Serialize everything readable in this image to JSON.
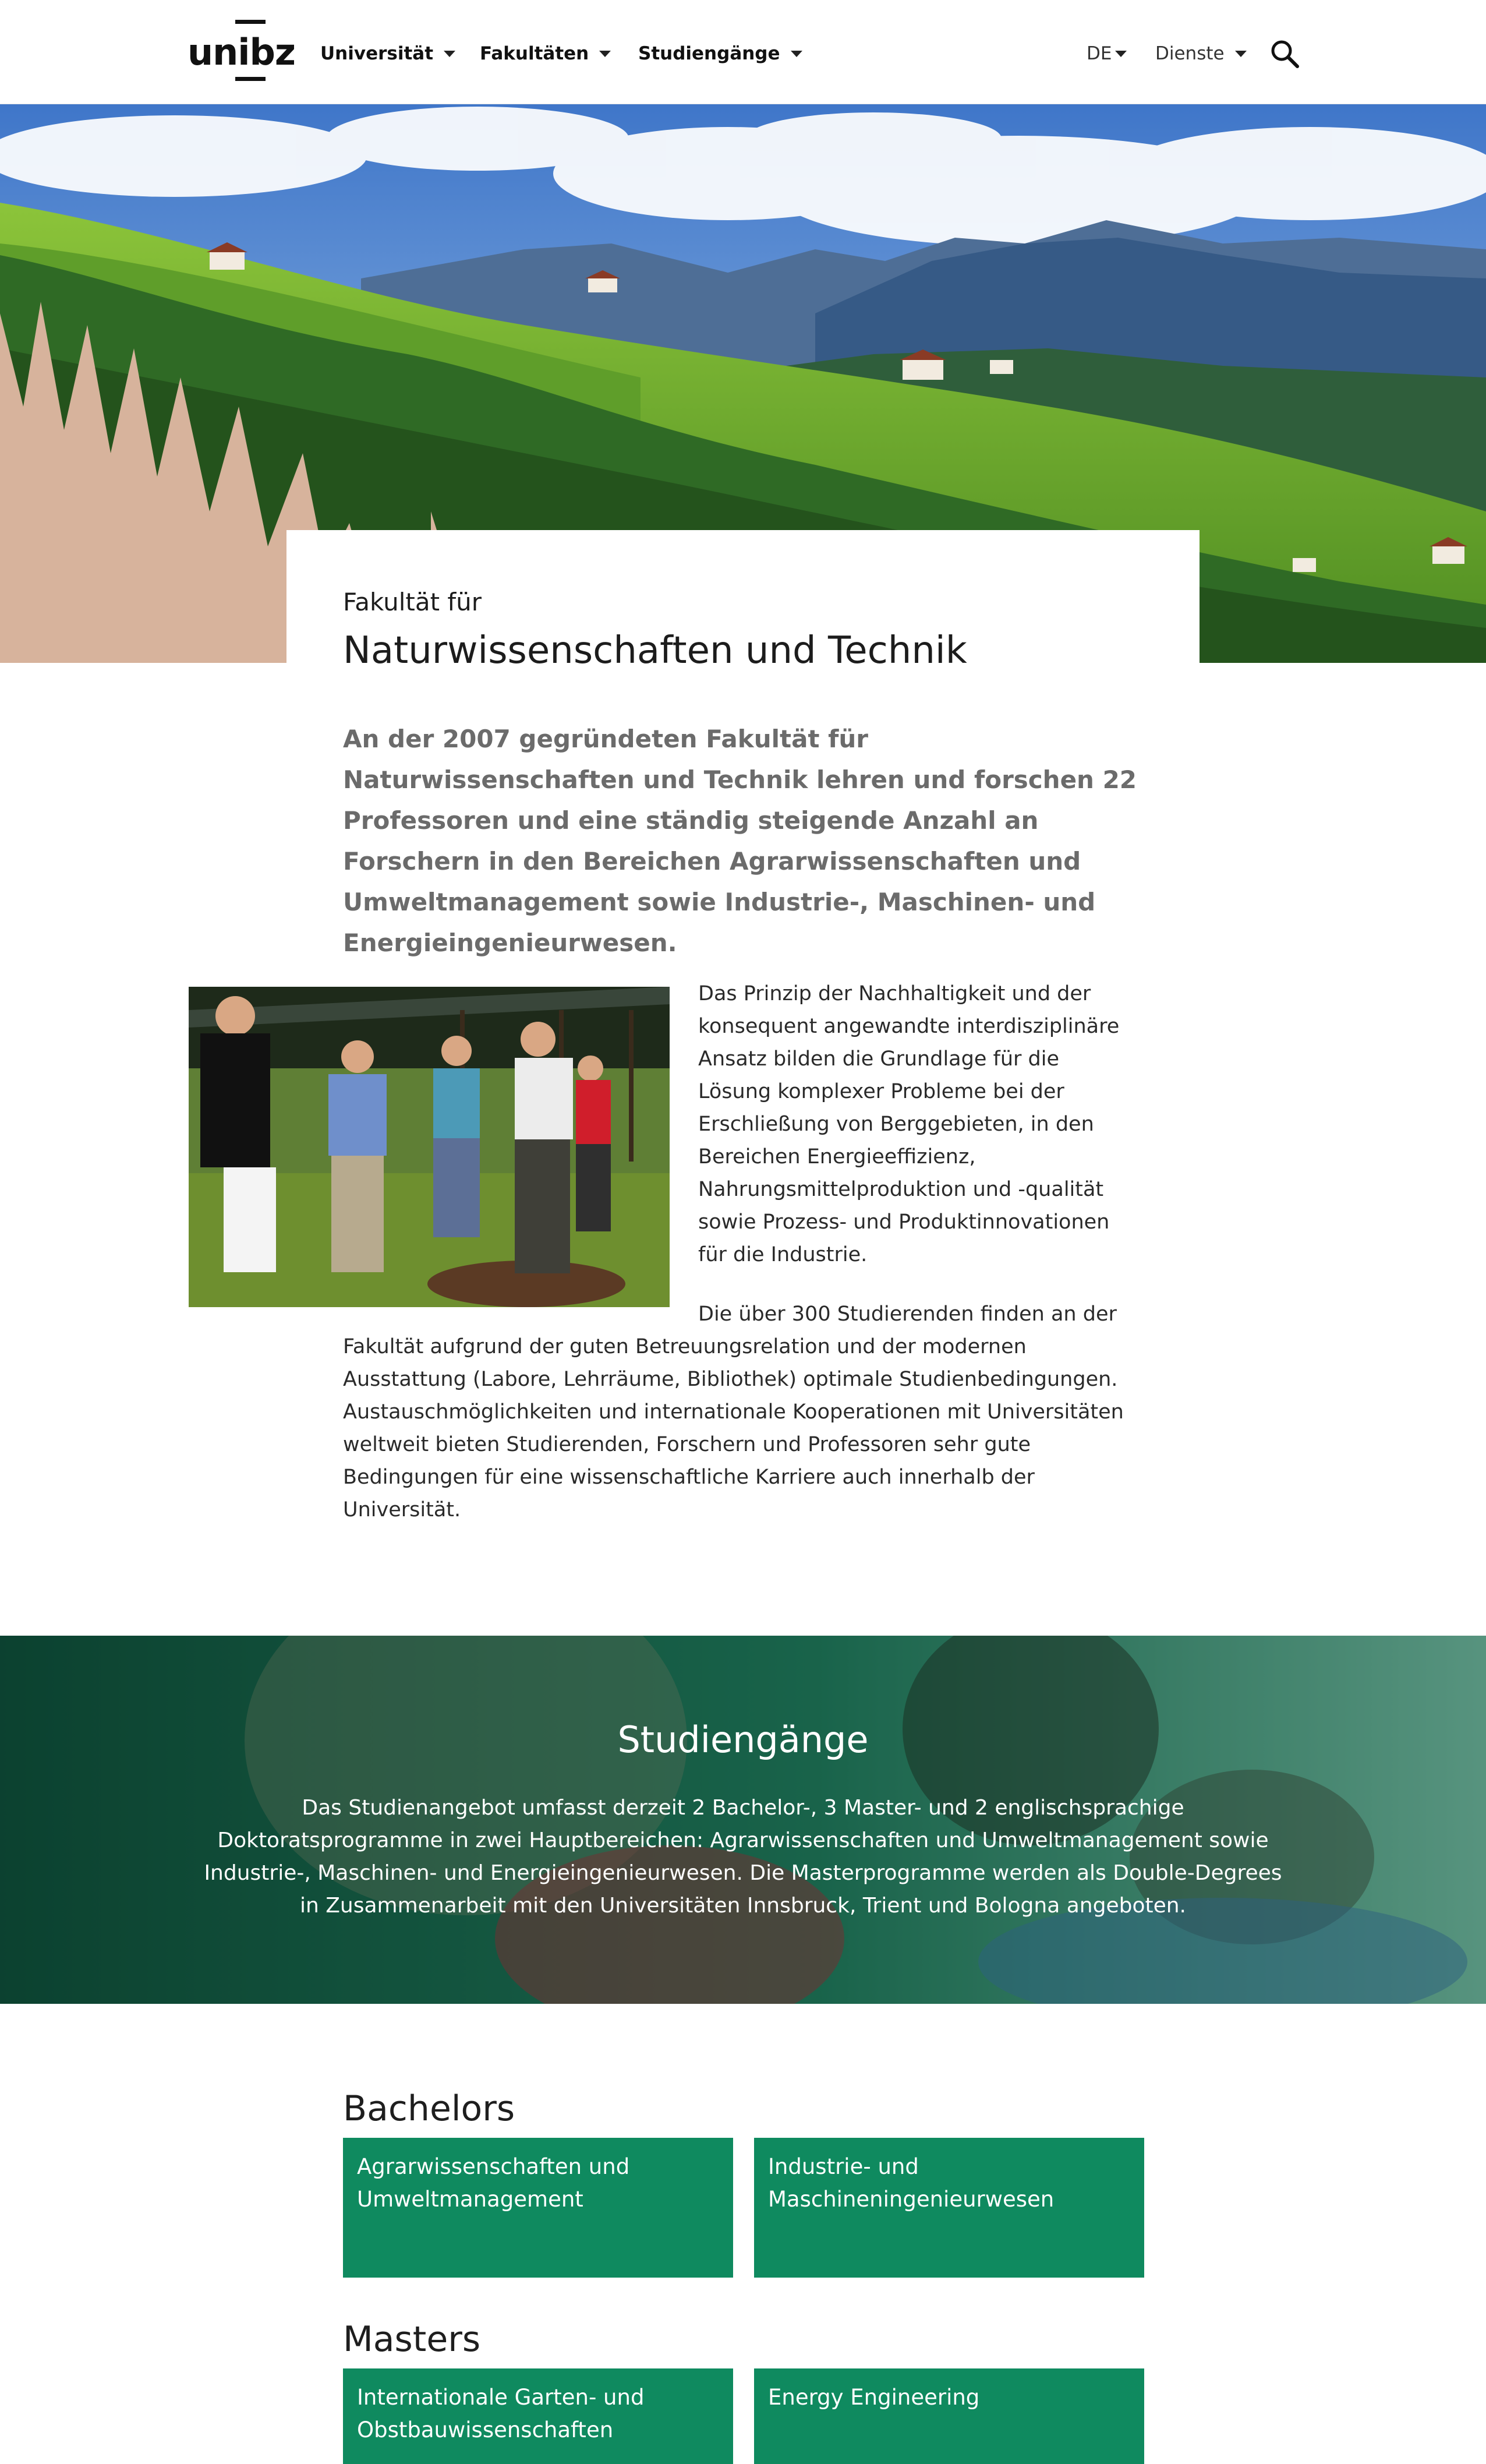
{
  "header": {
    "logo_text": "unibz",
    "nav": [
      {
        "label": "Universität"
      },
      {
        "label": "Fakultäten"
      },
      {
        "label": "Studiengänge"
      }
    ],
    "language": "DE",
    "services": "Dienste"
  },
  "intro": {
    "kicker": "Fakultät für",
    "title": "Naturwissenschaften und Technik",
    "lead": "An der 2007 gegründeten Fakultät für Naturwissenschaften und Technik lehren und forschen 22 Professoren und eine ständig steigende Anzahl an Forschern in den Bereichen Agrarwissenschaften und Umweltmanagement sowie Industrie-, Maschinen- und Energieingenieurwesen.",
    "paragraph_1": "Das Prinzip der Nachhaltigkeit und der konsequent angewandte interdisziplinäre Ansatz bilden die Grundlage für die Lösung komplexer Probleme bei der Erschließung von Berggebieten, in den Bereichen Energieeffizienz, Nahrungsmittelproduktion und -qualität sowie Prozess- und Produktinnovationen für die Industrie.",
    "paragraph_2": "Die über 300 Studierenden finden an der Fakultät aufgrund der guten Betreuungsrelation und der modernen Ausstattung (Labore, Lehrräume, Bibliothek) optimale Studienbedingungen. Austauschmöglichkeiten und internationale Kooperationen mit Universitäten weltweit bieten Studierenden, Forschern und Professoren sehr gute Bedingungen für eine wissenschaftliche Karriere auch innerhalb der Universität."
  },
  "studies": {
    "title": "Studiengänge",
    "text": "Das Studienangebot umfasst derzeit 2 Bachelor-, 3 Master- und 2 englischsprachige Doktoratsprogramme in zwei Hauptbereichen: Agrarwissenschaften und Umweltmanagement sowie Industrie-, Maschinen- und Energieingenieurwesen. Die Masterprogramme werden als Double-Degrees in Zusammenarbeit mit den Universitäten Innsbruck, Trient und Bologna angeboten."
  },
  "bachelors": {
    "heading": "Bachelors",
    "items": [
      {
        "label": "Agrarwissenschaften und Umweltmanagement"
      },
      {
        "label": "Industrie- und Maschineningenieurwesen"
      }
    ]
  },
  "masters": {
    "heading": "Masters",
    "items": [
      {
        "label": "Internationale Garten- und Obstbauwissenschaften"
      },
      {
        "label": "Energy Engineering"
      }
    ]
  },
  "colors": {
    "accent_green": "#0f8a5f",
    "band_overlay": "#0d4f3a"
  },
  "icons": [
    "chevron-down-icon",
    "search-icon"
  ]
}
